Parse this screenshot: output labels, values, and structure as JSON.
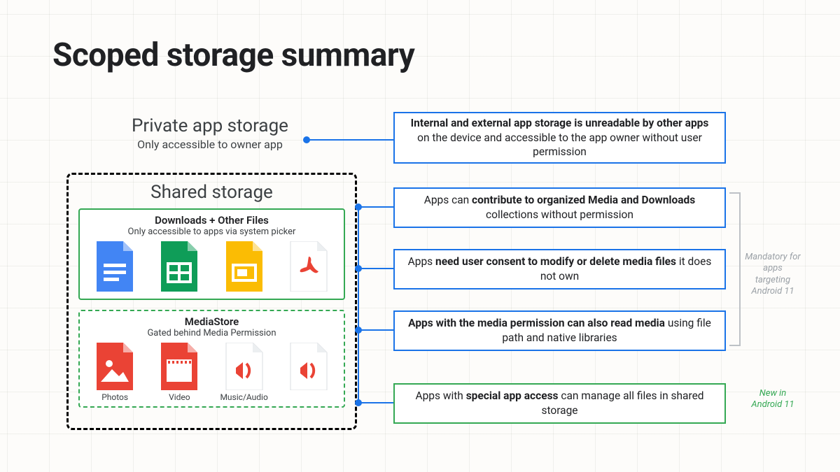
{
  "title": "Scoped storage summary",
  "private": {
    "heading": "Private app storage",
    "sub": "Only accessible to owner app"
  },
  "shared": {
    "heading": "Shared storage",
    "downloads": {
      "title": "Downloads + Other Files",
      "sub": "Only accessible to apps via system picker"
    },
    "mediastore": {
      "title": "MediaStore",
      "sub": "Gated behind Media Permission",
      "labels": {
        "photos": "Photos",
        "video": "Video",
        "music": "Music/Audio"
      }
    }
  },
  "boxes": {
    "b1_pre": "Internal and external app storage is unreadable by other apps",
    "b1_post": " on the device and accessible to the app owner without user permission",
    "b2_pre": "Apps can ",
    "b2_strong": "contribute to organized Media and Downloads",
    "b2_post": " collections without permission",
    "b3_pre": "Apps ",
    "b3_strong": "need user consent to modify or delete media files",
    "b3_post": " it does not own",
    "b4_strong": "Apps with the media permission can also read media",
    "b4_post": " using file path and native libraries",
    "b5_pre": "Apps with ",
    "b5_strong": "special app access",
    "b5_post": " can manage all files in shared storage"
  },
  "annotations": {
    "mandatory": "Mandatory for apps targeting Android 11",
    "new": "New in Android 11"
  },
  "colors": {
    "blue": "#1a73e8",
    "green": "#34a853",
    "yellow": "#fbbc04",
    "red": "#ea4335",
    "grey": "#9aa0a6"
  }
}
